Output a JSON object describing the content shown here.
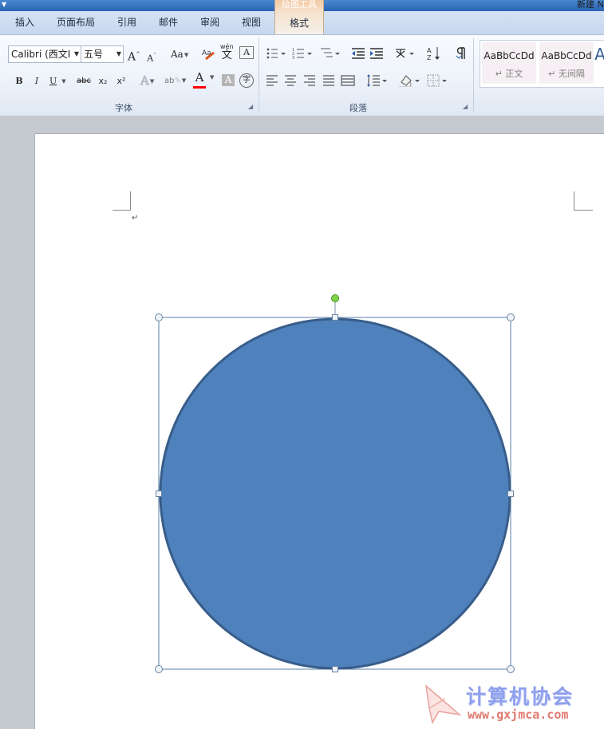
{
  "titlebar": {
    "context_group_label": "绘图工具",
    "doc_title_fragment": "新建 N"
  },
  "tabs": {
    "insert": "插入",
    "page_layout": "页面布局",
    "references": "引用",
    "mailings": "邮件",
    "review": "审阅",
    "view": "视图",
    "format": "格式"
  },
  "ribbon": {
    "font_group": {
      "label": "字体",
      "font_name": "Calibri (西文I",
      "font_size": "五号",
      "grow_font": "A",
      "shrink_font": "A",
      "change_case": "Aa",
      "clear_format_label": "A",
      "phonetic": "wén",
      "bold": "B",
      "italic": "I",
      "underline": "U",
      "strikethrough": "abc",
      "subscript": "x₂",
      "superscript": "x²",
      "text_effect": "A",
      "highlight": "ab",
      "font_color": "A",
      "char_shading": "A",
      "enclose_char": "字"
    },
    "paragraph_group": {
      "label": "段落"
    },
    "styles_group": {
      "items": [
        {
          "sample": "AaBbCcDd",
          "name": "↵ 正文"
        },
        {
          "sample": "AaBbCcDd",
          "name": "↵ 无间隔"
        },
        {
          "sample": "A",
          "name": ""
        }
      ]
    }
  },
  "document": {
    "paragraph_mark": "↵",
    "shape": {
      "type": "ellipse",
      "fill": "#4f81bd",
      "stroke": "#385d8a"
    }
  },
  "watermark": {
    "title": "计算机协会",
    "url": "www.gxjmca.com"
  },
  "colors": {
    "font_color_bar": "#ff0000",
    "selection_frame": "#5a7fa8",
    "rotate_handle": "#7ed348"
  }
}
